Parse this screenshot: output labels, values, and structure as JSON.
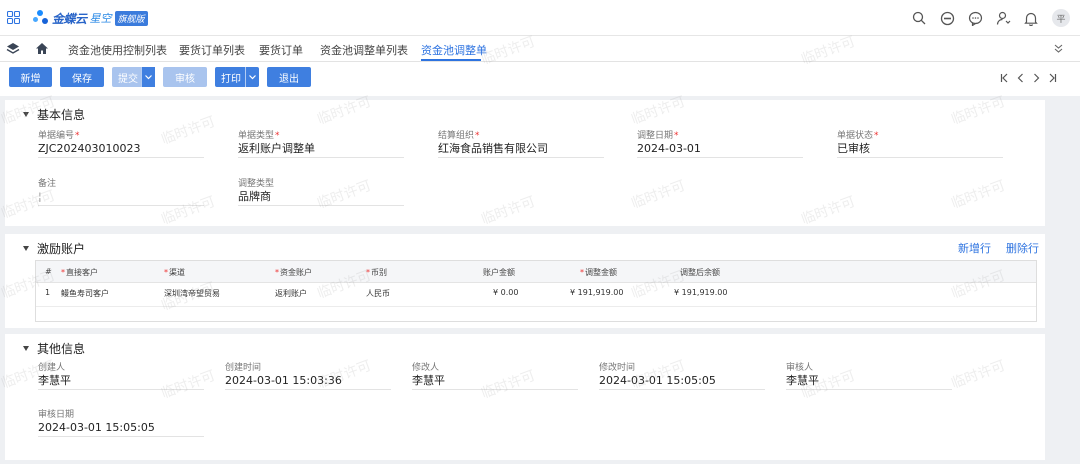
{
  "app": {
    "brand": "金蝶云",
    "sub": "星空",
    "edition": "旗舰版",
    "avatar_text": "平"
  },
  "tabs": [
    "资金池使用控制列表",
    "要货订单列表",
    "要货订单",
    "资金池调整单列表",
    "资金池调整单"
  ],
  "toolbar": {
    "new": "新增",
    "save": "保存",
    "submit": "提交",
    "audit": "审核",
    "print": "打印",
    "exit": "退出"
  },
  "basic": {
    "title": "基本信息",
    "fields": [
      {
        "label": "单据编号",
        "required": true,
        "value": "ZJC202403010023"
      },
      {
        "label": "单据类型",
        "required": true,
        "value": "返利账户调整单"
      },
      {
        "label": "结算组织",
        "required": true,
        "value": "红海食品销售有限公司"
      },
      {
        "label": "调整日期",
        "required": true,
        "value": "2024-03-01"
      },
      {
        "label": "单据状态",
        "required": true,
        "value": "已审核"
      },
      {
        "label": "备注",
        "required": false,
        "value": "¦"
      },
      {
        "label": "调整类型",
        "required": false,
        "value": "品牌商"
      }
    ]
  },
  "incentive": {
    "title": "激励账户",
    "add_row": "新增行",
    "delete_row": "删除行",
    "columns": [
      {
        "label": "#",
        "required": false
      },
      {
        "label": "直接客户",
        "required": true
      },
      {
        "label": "渠道",
        "required": true
      },
      {
        "label": "资金账户",
        "required": true
      },
      {
        "label": "币别",
        "required": true
      },
      {
        "label": "账户金额",
        "required": false
      },
      {
        "label": "调整金额",
        "required": true
      },
      {
        "label": "调整后余额",
        "required": false
      }
    ],
    "rows": [
      {
        "no": "1",
        "customer": "鳗鱼寿司客户",
        "channel": "深圳湾帝望贸易",
        "account": "返利账户",
        "currency": "人民币",
        "balance": "¥ 0.00",
        "adjust": "¥ 191,919.00",
        "after": "¥ 191,919.00"
      }
    ]
  },
  "other": {
    "title": "其他信息",
    "fields": [
      {
        "label": "创建人",
        "value": "李慧平"
      },
      {
        "label": "创建时间",
        "value": "2024-03-01 15:03:36"
      },
      {
        "label": "修改人",
        "value": "李慧平"
      },
      {
        "label": "修改时间",
        "value": "2024-03-01 15:05:05"
      },
      {
        "label": "审核人",
        "value": "李慧平"
      },
      {
        "label": "审核日期",
        "value": "2024-03-01 15:05:05"
      }
    ]
  },
  "watermark": "临时许可",
  "colors": {
    "primary": "#3f7fe0",
    "link": "#2d73e0",
    "required": "#e33333"
  }
}
